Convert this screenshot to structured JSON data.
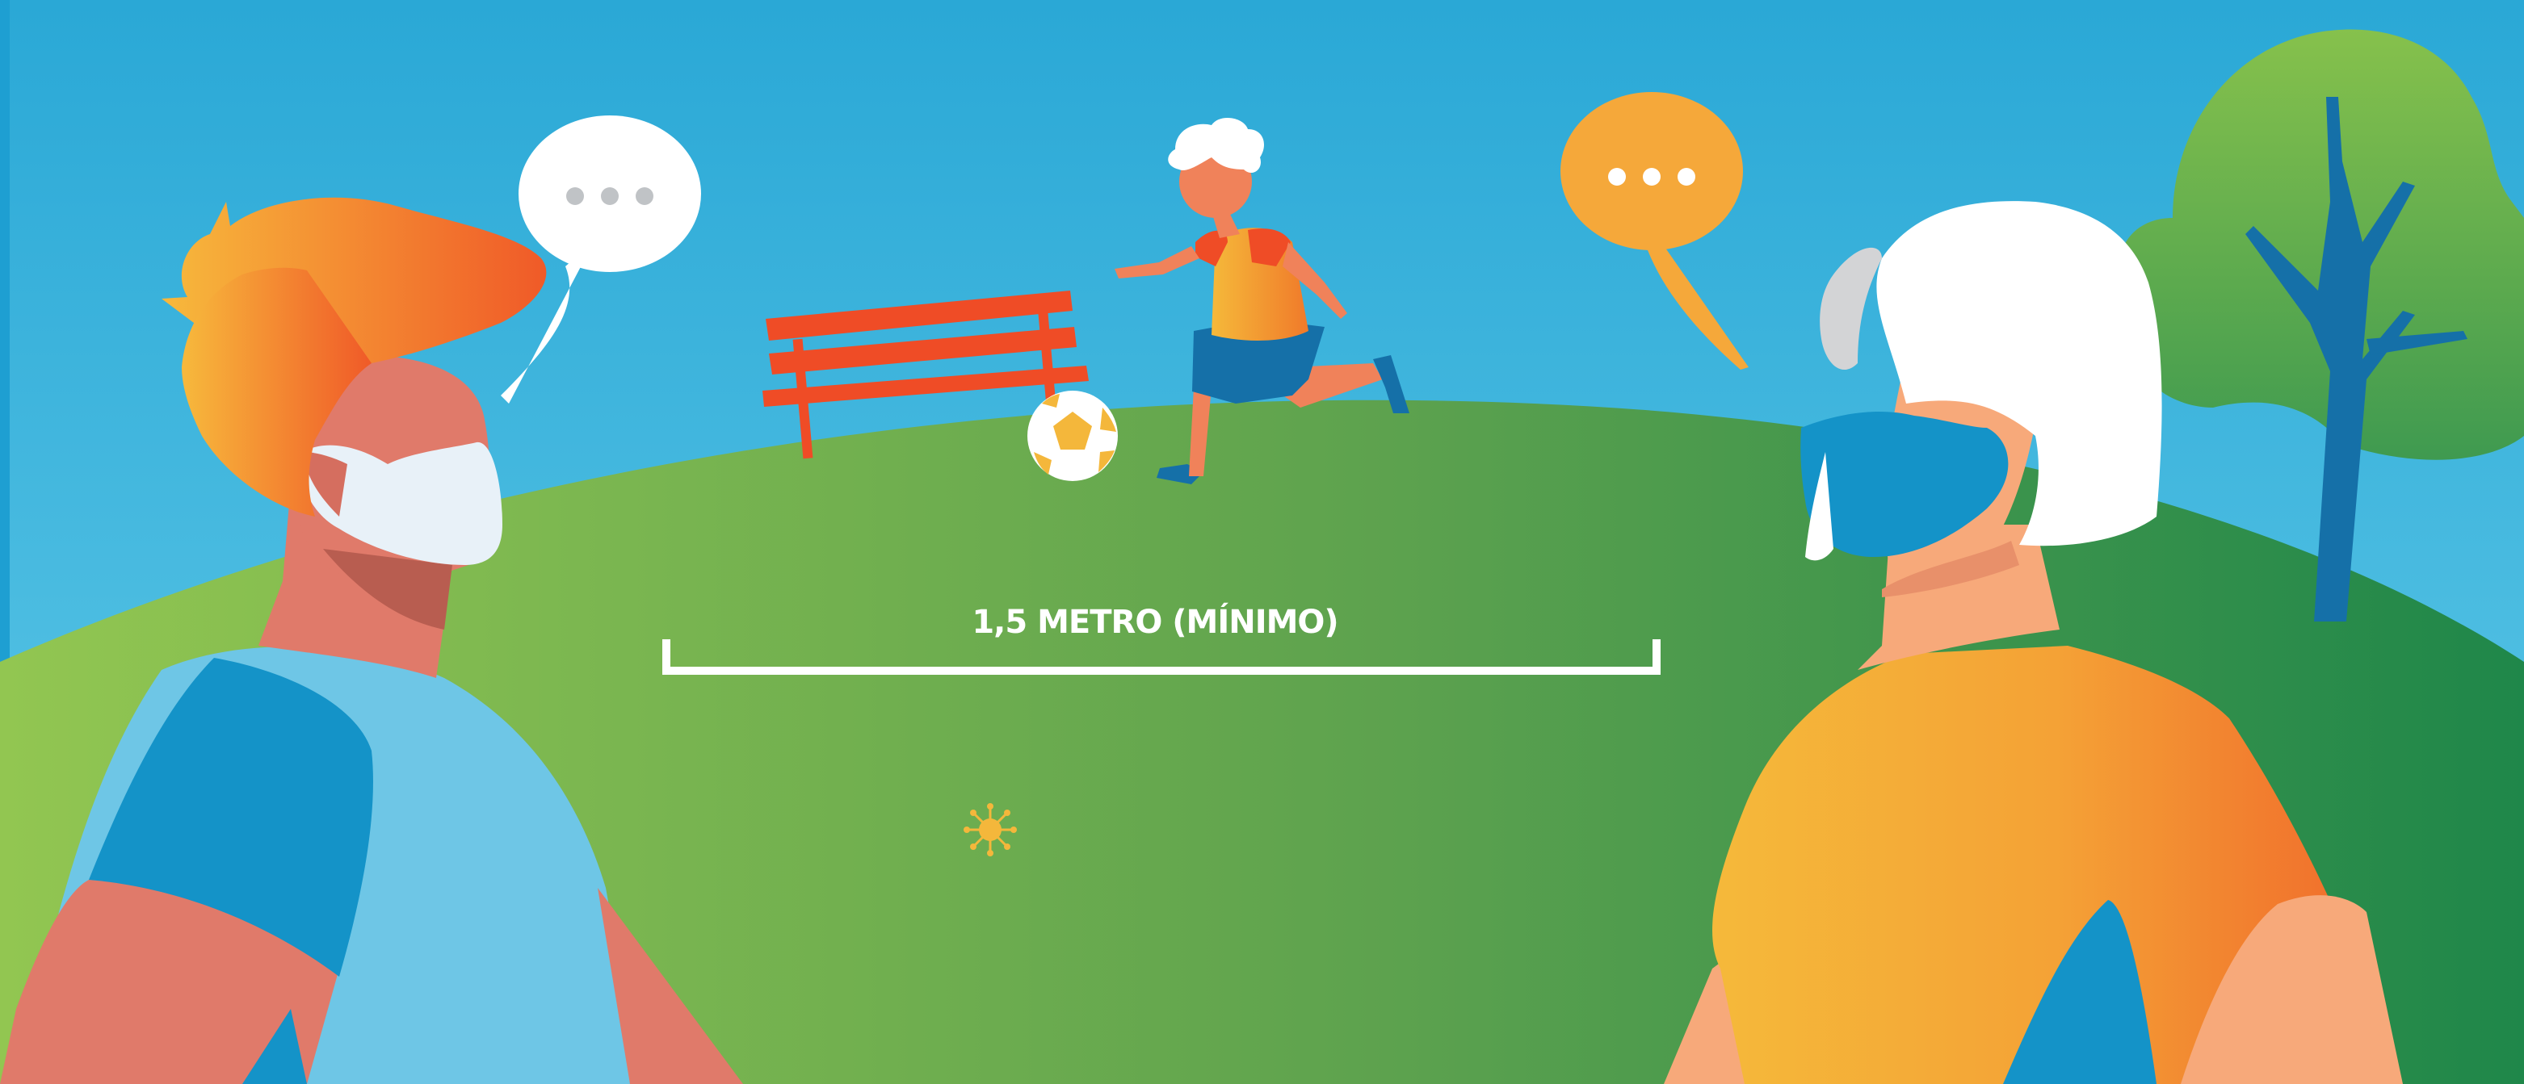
{
  "distance_label": "1,5 METRO (MÍNIMO)",
  "colors": {
    "sky_top": "#2aa8d6",
    "sky_bottom": "#5ec9e8",
    "grass_left": "#8cc250",
    "grass_right": "#1f874a",
    "bench": "#ef4c26",
    "speech_bubble_orange": "#f5a83a",
    "mask_blue": "#1493c8",
    "tree_green": "#7dbd4c",
    "tree_trunk": "#1570a8"
  },
  "icons": [
    "speech-bubble-icon",
    "soccer-ball-icon",
    "virus-icon",
    "park-bench-icon",
    "tree-icon"
  ]
}
